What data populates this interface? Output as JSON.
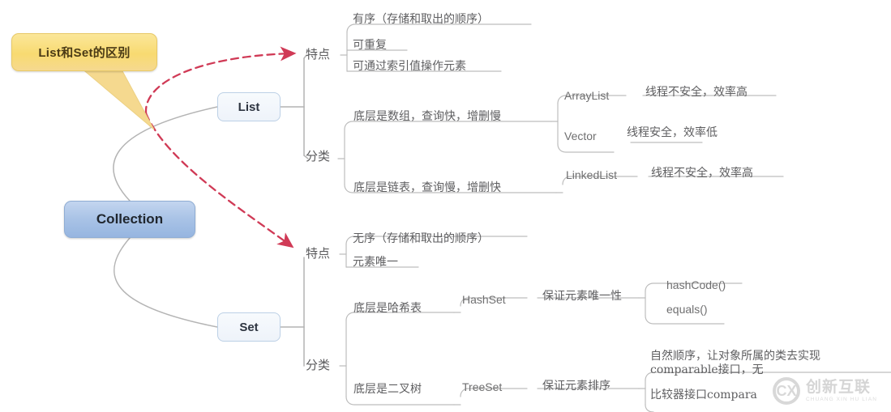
{
  "title": "List和Set的区别",
  "colors": {
    "callout_fill": "#f8da71",
    "callout_border": "#e8c968",
    "root_fill": "#a9c3e6",
    "root_border": "#8fadd4",
    "leaf_fill": "#eef3fa",
    "leaf_border": "#bcd0e6",
    "connector": "#b4b4b4",
    "highlight_arrow": "#d03a56",
    "text": "#5e5e60"
  },
  "callout": {
    "label": "List和Set的区别"
  },
  "root": {
    "label": "Collection"
  },
  "branches": [
    {
      "label": "List",
      "groups": [
        {
          "label": "特点",
          "items": [
            {
              "text": "有序（存储和取出的顺序）"
            },
            {
              "text": "可重复"
            },
            {
              "text": "可通过索引值操作元素"
            }
          ]
        },
        {
          "label": "分类",
          "items": [
            {
              "text": "底层是数组，查询快，增删慢",
              "children": [
                {
                  "text": "ArrayList",
                  "note": "线程不安全，效率高"
                },
                {
                  "text": "Vector",
                  "note": "线程安全，效率低"
                }
              ]
            },
            {
              "text": "底层是链表，查询慢，增删快",
              "children": [
                {
                  "text": "LinkedList",
                  "note": "线程不安全，效率高"
                }
              ]
            }
          ]
        }
      ]
    },
    {
      "label": "Set",
      "groups": [
        {
          "label": "特点",
          "items": [
            {
              "text": "无序（存储和取出的顺序）"
            },
            {
              "text": "元素唯一"
            }
          ]
        },
        {
          "label": "分类",
          "items": [
            {
              "text": "底层是哈希表",
              "children": [
                {
                  "text": "HashSet",
                  "note": "保证元素唯一性",
                  "leaves": [
                    "hashCode()",
                    "equals()"
                  ]
                }
              ]
            },
            {
              "text": "底层是二叉树",
              "children": [
                {
                  "text": "TreeSet",
                  "note": "保证元素排序",
                  "leaves": [
                    "自然顺序，让对象所属的类去实现comparable接口，无",
                    "比较器接口compara"
                  ]
                }
              ]
            }
          ]
        }
      ]
    }
  ],
  "watermark": {
    "cn": "创新互联",
    "en": "CHUANG XIN HU LIAN",
    "mark": "CX"
  }
}
